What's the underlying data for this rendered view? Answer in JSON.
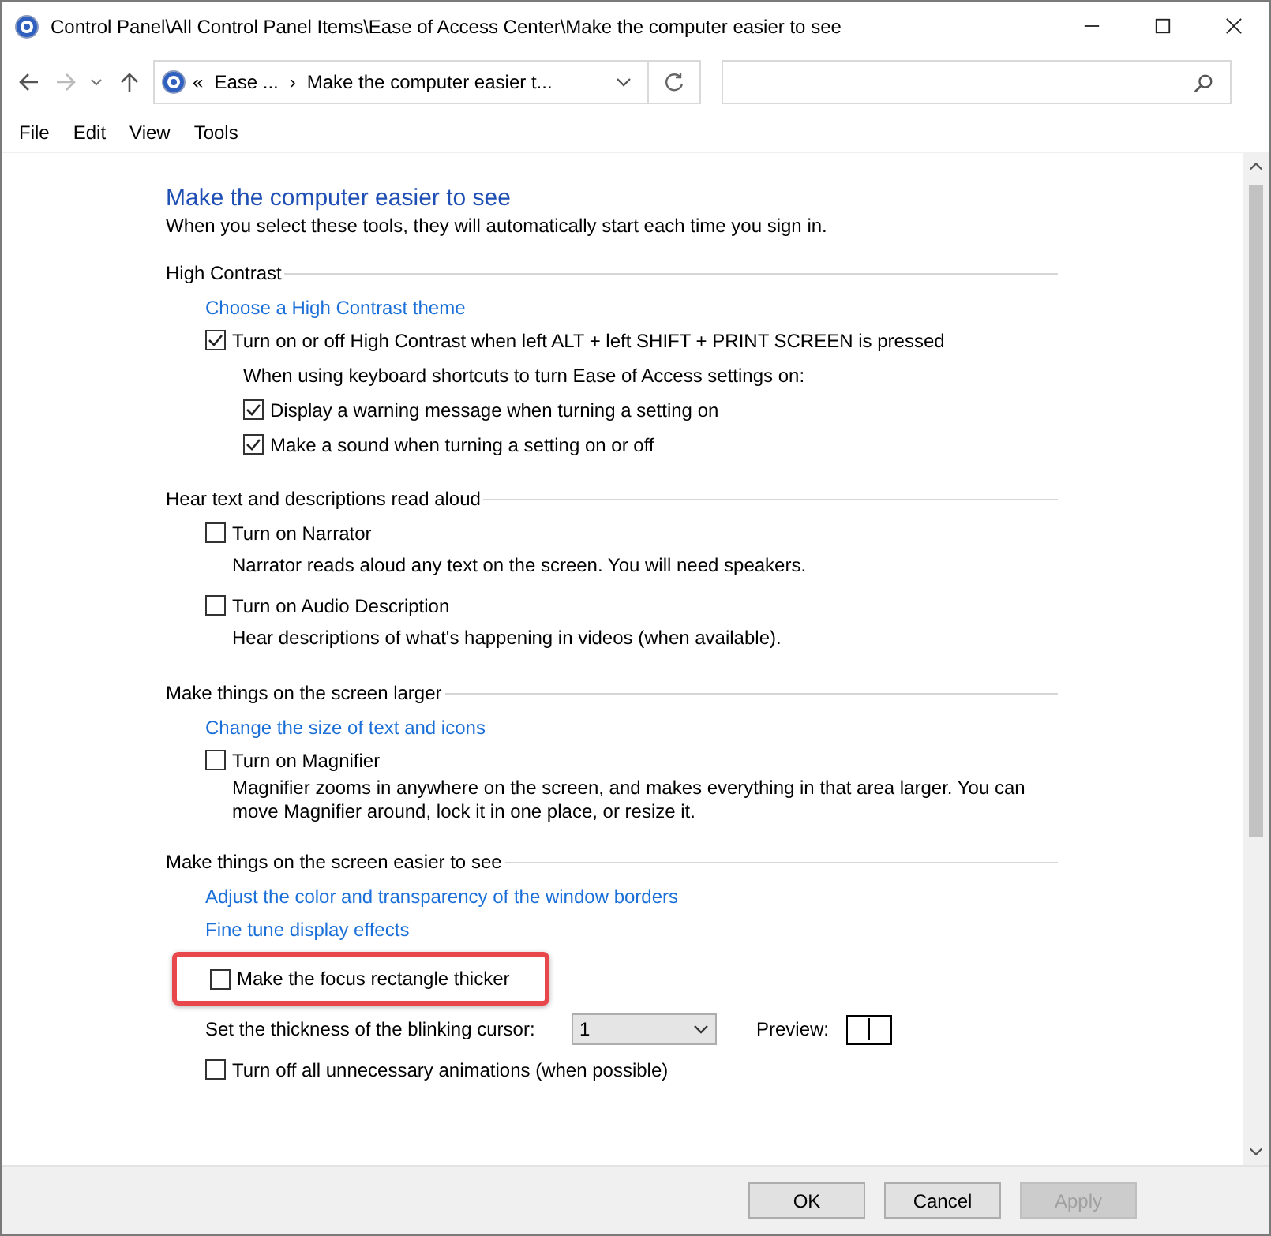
{
  "window": {
    "title": "Control Panel\\All Control Panel Items\\Ease of Access Center\\Make the computer easier to see"
  },
  "address": {
    "crumbs": [
      "«",
      "Ease ...",
      "›",
      "Make the computer easier t..."
    ]
  },
  "menu": [
    "File",
    "Edit",
    "View",
    "Tools"
  ],
  "page": {
    "title": "Make the computer easier to see",
    "subtitle": "When you select these tools, they will automatically start each time you sign in."
  },
  "sections": [
    {
      "heading": "High Contrast",
      "items": [
        {
          "kind": "link",
          "text": "Choose a High Contrast theme"
        },
        {
          "kind": "checkbox",
          "text": "Turn on or off High Contrast when left ALT + left SHIFT + PRINT SCREEN is pressed",
          "checked": true,
          "highlighted": false,
          "children": [
            {
              "kind": "note",
              "text": "When using keyboard shortcuts to turn Ease of Access settings on:"
            },
            {
              "kind": "checkbox",
              "text": "Display a warning message when turning a setting on",
              "checked": true
            },
            {
              "kind": "checkbox",
              "text": "Make a sound when turning a setting on or off",
              "checked": true
            }
          ]
        }
      ]
    },
    {
      "heading": "Hear text and descriptions read aloud",
      "items": [
        {
          "kind": "checkbox",
          "text": "Turn on Narrator",
          "checked": false,
          "highlighted": false,
          "children": [
            {
              "kind": "note",
              "text": "Narrator reads aloud any text on the screen. You will need speakers."
            }
          ]
        },
        {
          "kind": "checkbox",
          "text": "Turn on Audio Description",
          "checked": false,
          "highlighted": false,
          "children": [
            {
              "kind": "note",
              "text": "Hear descriptions of what's happening in videos (when available)."
            }
          ]
        }
      ]
    },
    {
      "heading": "Make things on the screen larger",
      "items": [
        {
          "kind": "link",
          "text": "Change the size of text and icons"
        },
        {
          "kind": "checkbox",
          "text": "Turn on Magnifier",
          "checked": false,
          "highlighted": false,
          "children": [
            {
              "kind": "note",
              "text": "Magnifier zooms in anywhere on the screen, and makes everything in that area larger. You can move Magnifier around, lock it in one place, or resize it."
            }
          ]
        }
      ]
    },
    {
      "heading": "Make things on the screen easier to see",
      "items": [
        {
          "kind": "link",
          "text": "Adjust the color and transparency of the window borders"
        },
        {
          "kind": "link",
          "text": "Fine tune display effects"
        },
        {
          "kind": "checkbox",
          "text": "Make the focus rectangle thicker",
          "checked": false,
          "highlighted": true
        },
        {
          "kind": "cursor",
          "text": "Set the thickness of the blinking cursor:",
          "value": "1",
          "preview": "Preview:"
        },
        {
          "kind": "checkbox",
          "text": "Turn off all unnecessary animations (when possible)",
          "checked": false,
          "highlighted": false
        }
      ]
    }
  ],
  "buttons": [
    {
      "label": "OK",
      "disabled": false
    },
    {
      "label": "Cancel",
      "disabled": false
    },
    {
      "label": "Apply",
      "disabled": true
    }
  ]
}
